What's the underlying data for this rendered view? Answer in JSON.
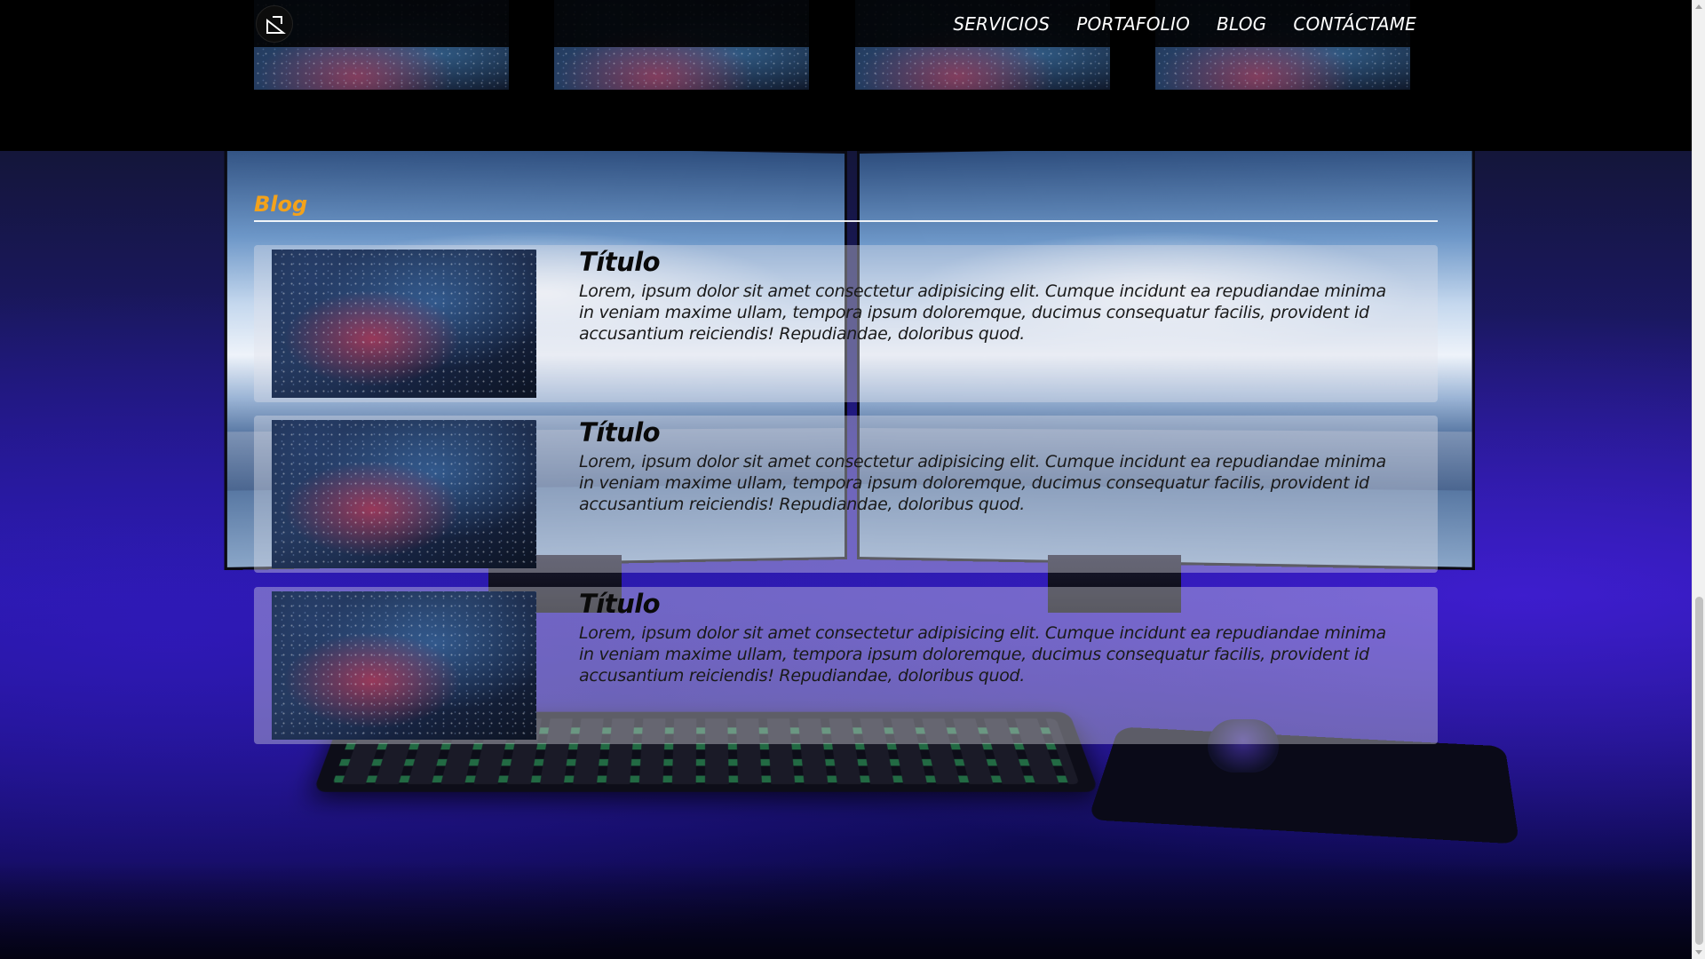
{
  "navbar": {
    "logo_name": "logo-icon",
    "links": [
      {
        "label": "SERVICIOS"
      },
      {
        "label": "PORTAFOLIO"
      },
      {
        "label": "BLOG"
      },
      {
        "label": "CONTÁCTAME"
      }
    ]
  },
  "portfolio_strip": {
    "thumbnails": [
      "galaxy-image",
      "galaxy-image",
      "galaxy-image",
      "galaxy-image"
    ]
  },
  "blog": {
    "heading": "Blog",
    "heading_color": "#f3a21b",
    "posts": [
      {
        "title": "Título",
        "body": "Lorem, ipsum dolor sit amet consectetur adipisicing elit. Cumque incidunt ea repudiandae minima in veniam maxime ullam, tempora ipsum doloremque, ducimus consequatur facilis, provident id accusantium reiciendis! Repudiandae, doloribus quod."
      },
      {
        "title": "Título",
        "body": "Lorem, ipsum dolor sit amet consectetur adipisicing elit. Cumque incidunt ea repudiandae minima in veniam maxime ullam, tempora ipsum doloremque, ducimus consequatur facilis, provident id accusantium reiciendis! Repudiandae, doloribus quod."
      },
      {
        "title": "Título",
        "body": "Lorem, ipsum dolor sit amet consectetur adipisicing elit. Cumque incidunt ea repudiandae minima in veniam maxime ullam, tempora ipsum doloremque, ducimus consequatur facilis, provident id accusantium reiciendis! Repudiandae, doloribus quod."
      }
    ]
  }
}
